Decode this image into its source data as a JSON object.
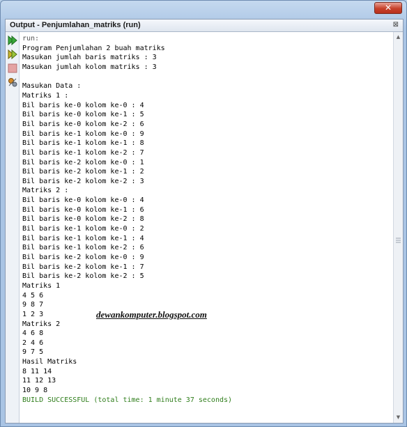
{
  "window": {
    "close_label": "✕"
  },
  "panel": {
    "title": "Output - Penjumlahan_matriks (run)",
    "close_label": "⊠"
  },
  "toolbar": {
    "icons": [
      "rerun-icon",
      "rerun-debug-icon",
      "stop-icon",
      "settings-icon"
    ]
  },
  "output": {
    "lines": [
      "run:",
      "Program Penjumlahan 2 buah matriks",
      "Masukan jumlah baris matriks : 3",
      "Masukan jumlah kolom matriks : 3",
      "",
      "Masukan Data :",
      "Matriks 1 :",
      "Bil baris ke-0 kolom ke-0 : 4",
      "Bil baris ke-0 kolom ke-1 : 5",
      "Bil baris ke-0 kolom ke-2 : 6",
      "Bil baris ke-1 kolom ke-0 : 9",
      "Bil baris ke-1 kolom ke-1 : 8",
      "Bil baris ke-1 kolom ke-2 : 7",
      "Bil baris ke-2 kolom ke-0 : 1",
      "Bil baris ke-2 kolom ke-1 : 2",
      "Bil baris ke-2 kolom ke-2 : 3",
      "Matriks 2 :",
      "Bil baris ke-0 kolom ke-0 : 4",
      "Bil baris ke-0 kolom ke-1 : 6",
      "Bil baris ke-0 kolom ke-2 : 8",
      "Bil baris ke-1 kolom ke-0 : 2",
      "Bil baris ke-1 kolom ke-1 : 4",
      "Bil baris ke-1 kolom ke-2 : 6",
      "Bil baris ke-2 kolom ke-0 : 9",
      "Bil baris ke-2 kolom ke-1 : 7",
      "Bil baris ke-2 kolom ke-2 : 5",
      "Matriks 1",
      "4 5 6",
      "9 8 7",
      "1 2 3",
      "Matriks 2",
      "4 6 8",
      "2 4 6",
      "9 7 5",
      "Hasil Matriks",
      "8 11 14",
      "11 12 13",
      "10 9 8",
      "BUILD SUCCESSFUL (total time: 1 minute 37 seconds)"
    ]
  },
  "watermark": "dewankomputer.blogspot.com",
  "colors": {
    "success": "#2e7d1a",
    "run": "#555555"
  }
}
